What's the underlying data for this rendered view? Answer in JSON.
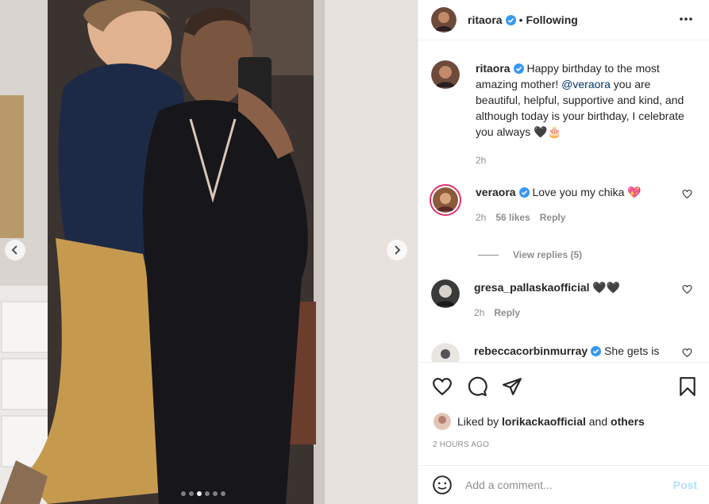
{
  "header": {
    "username": "ritaora",
    "follow_state": "Following",
    "separator": "•"
  },
  "caption": {
    "username": "ritaora",
    "text_before": "Happy birthday to the most amazing mother! ",
    "mention": "@veraora",
    "text_after": " you are beautiful, helpful, supportive and kind, and although today is your birthday, I celebrate you always 🖤🎂",
    "time": "2h"
  },
  "comments": [
    {
      "username": "veraora",
      "text": "Love you my chika 💖",
      "time": "2h",
      "likes": "56 likes",
      "reply": "Reply",
      "verified": true
    },
    {
      "username": "gresa_pallaskaofficial",
      "text": "🖤🖤",
      "time": "2h",
      "reply": "Reply",
      "verified": false
    },
    {
      "username": "rebeccacorbinmurray",
      "text": "She gets is",
      "verified": true
    }
  ],
  "view_replies": "View replies (5)",
  "likes": {
    "prefix": "Liked by",
    "user": "lorikackaofficial",
    "joiner": "and",
    "others": "others"
  },
  "timestamp": "2 HOURS AGO",
  "add_comment": {
    "placeholder": "Add a comment...",
    "post_label": "Post"
  },
  "carousel": {
    "slide_count": 6,
    "active_index": 2
  },
  "colors": {
    "link": "#00376b",
    "muted": "#8e8e8e",
    "post_disabled": "#b2dffc",
    "verified": "#3897f0"
  }
}
